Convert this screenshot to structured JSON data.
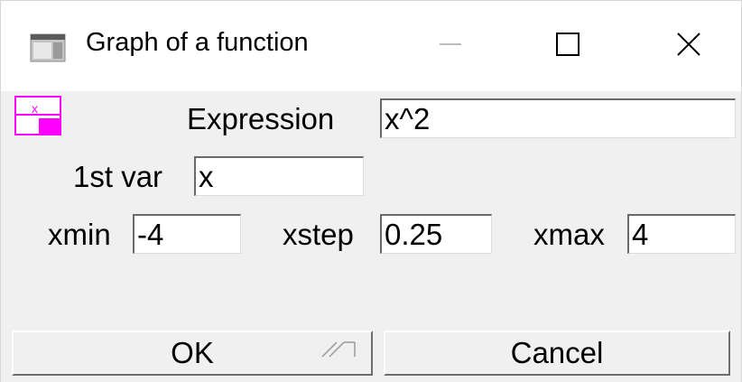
{
  "window": {
    "title": "Graph of a function"
  },
  "form": {
    "expression_label": "Expression",
    "expression_value": "x^2",
    "var_label": "1st var",
    "var_value": "x",
    "xmin_label": "xmin",
    "xmin_value": "-4",
    "xstep_label": "xstep",
    "xstep_value": "0.25",
    "xmax_label": "xmax",
    "xmax_value": "4"
  },
  "buttons": {
    "ok_label": "OK",
    "cancel_label": "Cancel"
  },
  "icons": {
    "app": "app-window-icon",
    "function": "function-graph-icon",
    "minimize": "minimize-icon",
    "maximize": "maximize-icon",
    "close": "close-icon",
    "resize": "resize-grip-icon"
  },
  "colors": {
    "accent_magenta": "#ff00ff",
    "window_background": "#f0f0f0",
    "titlebar_background": "#ffffff"
  }
}
